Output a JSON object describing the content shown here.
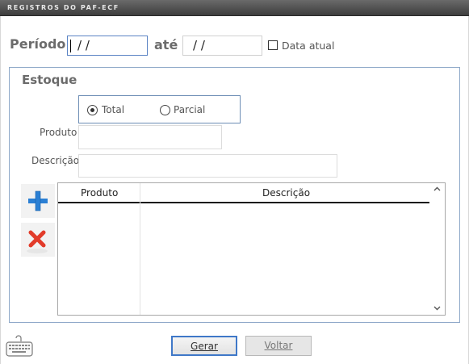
{
  "window": {
    "title": "Registros do PAF-ECF"
  },
  "periodo": {
    "label": "Período",
    "start_value": "/ /",
    "separator_label": "até",
    "end_value": "/ /",
    "data_atual_label": "Data atual",
    "data_atual_checked": false
  },
  "estoque": {
    "title": "Estoque",
    "options": [
      {
        "label": "Total",
        "selected": true
      },
      {
        "label": "Parcial",
        "selected": false
      }
    ],
    "produto_label": "Produto",
    "produto_value": "",
    "descricao_label": "Descrição",
    "descricao_value": "",
    "add_icon": "plus-icon",
    "remove_icon": "x-delete-icon",
    "grid": {
      "columns": [
        "Produto",
        "Descrição"
      ],
      "rows": []
    }
  },
  "footer": {
    "keyboard_icon": "keyboard-icon",
    "gerar_label": "Gerar",
    "voltar_label": "Voltar"
  }
}
